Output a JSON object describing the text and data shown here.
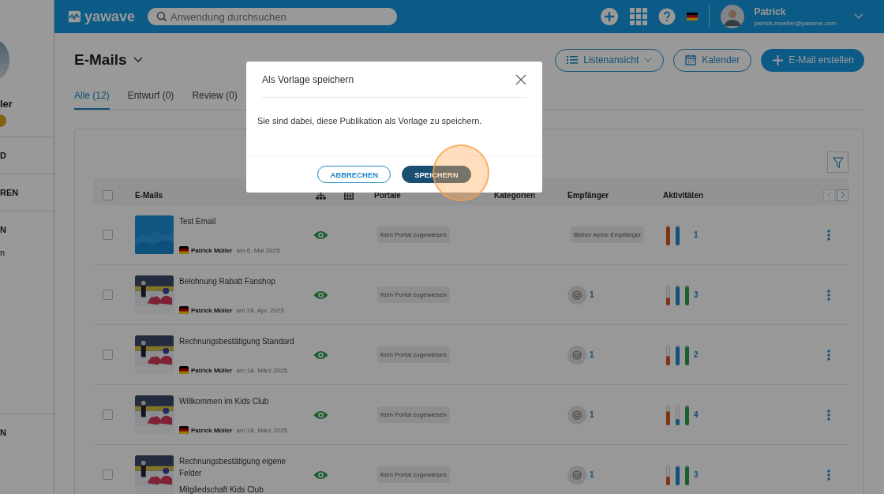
{
  "sidebar": {
    "items": [
      {
        "label": "ler"
      },
      {
        "label": "D"
      },
      {
        "label": "REN"
      },
      {
        "label": "N"
      },
      {
        "label": "n"
      },
      {
        "label": "N"
      }
    ]
  },
  "header": {
    "logo": "yawave",
    "search": {
      "placeholder": "Anwendung durchsuchen"
    },
    "user": {
      "name": "Patrick",
      "email": "patrick.mueller@yawave.com"
    }
  },
  "page": {
    "title": "E-Mails",
    "buttons": [
      {
        "label": "Listenansicht",
        "kind": "list"
      },
      {
        "label": "Kalender",
        "kind": "calendar"
      },
      {
        "label": "E-Mail erstellen",
        "kind": "create"
      }
    ]
  },
  "tabs": [
    {
      "label": "Alle (12)",
      "selected": true
    },
    {
      "label": "Entwurf (0)",
      "selected": false
    },
    {
      "label": "Review (0)",
      "selected": false
    }
  ],
  "table": {
    "all_checked": false,
    "columns": [
      "E-Mails",
      "Portale",
      "Kategorien",
      "Empfänger",
      "Aktivitäten"
    ],
    "rows": [
      {
        "checked": false,
        "title": "Test Email",
        "author": "Patrick Müller",
        "date": "am 6. Mai 2025",
        "portal": "Kein Portal zugewiesen",
        "recipients": {
          "kind": "badge",
          "text": "Bisher keine Empfänger"
        },
        "activity": [
          {
            "level": 1
          },
          {
            "level": 1
          }
        ],
        "activity_count": "1"
      },
      {
        "checked": false,
        "title": "Belohnung Rabatt Fanshop",
        "author": "Patrick Müller",
        "date": "am 28. Apr. 2025",
        "portal": "Kein Portal zugewiesen",
        "recipients": {
          "kind": "count",
          "text": "1"
        },
        "activity": [
          {
            "level": 0.4
          },
          {
            "level": 1
          },
          {
            "level": 1
          }
        ],
        "activity_count": "3"
      },
      {
        "checked": false,
        "title": "Rechnungsbestätigung Standard",
        "author": "Patrick Müller",
        "date": "am 18. März 2025",
        "portal": "Kein Portal zugewiesen",
        "recipients": {
          "kind": "count",
          "text": "1"
        },
        "activity": [
          {
            "level": 0.5
          },
          {
            "level": 1
          },
          {
            "level": 1
          }
        ],
        "activity_count": "2"
      },
      {
        "checked": false,
        "title": "Willkommen im Kids Club",
        "author": "Patrick Müller",
        "date": "am 18. März 2025",
        "portal": "Kein Portal zugewiesen",
        "recipients": {
          "kind": "count",
          "text": "1"
        },
        "activity": [
          {
            "level": 0.75
          },
          {
            "level": 0.3
          },
          {
            "level": 1
          }
        ],
        "activity_count": "4"
      },
      {
        "checked": false,
        "title": "Rechnungsbestätigung eigene Felder",
        "subtitle": "Mitgliedschaft Kids Club",
        "portal": "Kein Portal zugewiesen",
        "recipients": {
          "kind": "count",
          "text": "1"
        },
        "activity": [
          {
            "level": 0.45
          },
          {
            "level": 1
          },
          {
            "level": 1
          }
        ],
        "activity_count": "3"
      }
    ]
  },
  "dialog": {
    "title": "Als Vorlage speichern",
    "message": "Sie sind dabei, diese Publikation als Vorlage zu speichern.",
    "buttons": [
      {
        "label": "ABBRECHEN",
        "kind": "secondary"
      },
      {
        "label": "SPEICHERN",
        "kind": "primary",
        "highlighted": true
      }
    ]
  }
}
